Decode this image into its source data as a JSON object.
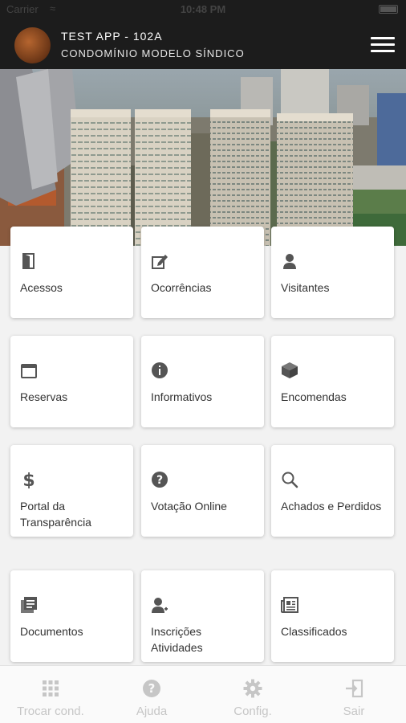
{
  "status_bar": {
    "carrier": "Carrier",
    "time": "10:48 PM"
  },
  "header": {
    "title": "TEST APP - 102A",
    "subtitle": "CONDOMÍNIO MODELO SÍNDICO"
  },
  "colors": {
    "header_bg": "#1c1c1c",
    "icon": "#555555",
    "tab_inactive": "#c6c6c6"
  },
  "menu": [
    {
      "label": "Acessos",
      "icon": "door-icon"
    },
    {
      "label": "Ocorrências",
      "icon": "edit-icon"
    },
    {
      "label": "Visitantes",
      "icon": "person-icon"
    },
    {
      "label": "Reservas",
      "icon": "calendar-icon"
    },
    {
      "label": "Informativos",
      "icon": "info-icon"
    },
    {
      "label": "Encomendas",
      "icon": "package-icon"
    },
    {
      "label": "Portal da Transparência",
      "icon": "dollar-icon"
    },
    {
      "label": "Votação Online",
      "icon": "question-icon"
    },
    {
      "label": "Achados e Perdidos",
      "icon": "search-icon"
    },
    {
      "label": "Documentos",
      "icon": "documents-icon"
    },
    {
      "label": "Inscrições Atividades",
      "icon": "person-plus-icon"
    },
    {
      "label": "Classificados",
      "icon": "newspaper-icon"
    }
  ],
  "tabs": [
    {
      "label": "Trocar cond.",
      "icon": "grid-icon"
    },
    {
      "label": "Ajuda",
      "icon": "help-icon"
    },
    {
      "label": "Config.",
      "icon": "gear-icon"
    },
    {
      "label": "Sair",
      "icon": "exit-icon"
    }
  ]
}
